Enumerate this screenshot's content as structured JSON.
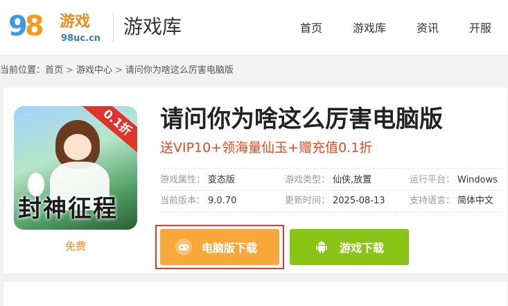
{
  "header": {
    "logo_digits": "98",
    "logo_brand": "游戏",
    "logo_domain": "98uc.cn",
    "section_title": "游戏库",
    "nav": [
      "首页",
      "游戏库",
      "资讯",
      "开服"
    ]
  },
  "breadcrumb": {
    "prefix": "当前位置：",
    "items": [
      "首页",
      "游戏中心",
      "请问你为啥这么厉害电脑版"
    ],
    "separator": ">"
  },
  "game": {
    "cover_title": "封神征程",
    "cover_badge": "0.1折",
    "price_label": "免费",
    "title": "请问你为啥这么厉害电脑版",
    "promo": "送VIP10+领海量仙玉+赠充值0.1折",
    "attributes": {
      "type_label": "游戏属性：",
      "type_value": "变态版",
      "genre_label": "游戏类型：",
      "genre_value": "仙侠,放置",
      "platform_label": "运行平台：",
      "platform_value": "Windows",
      "version_label": "当前版本：",
      "version_value": "9.0.70",
      "updated_label": "更新时间：",
      "updated_value": "2025-08-13",
      "language_label": "支持语言：",
      "language_value": "简体中文"
    }
  },
  "buttons": {
    "pc_download": "电脑版下载",
    "game_download": "游戏下载"
  },
  "colors": {
    "accent_orange": "#f8a83b",
    "accent_green": "#8ac417",
    "promo_red": "#e8481e",
    "highlight_border": "#d93a3a"
  },
  "icons": {
    "pc_button_icon": "gamepad-icon",
    "game_button_icon": "android-icon"
  }
}
